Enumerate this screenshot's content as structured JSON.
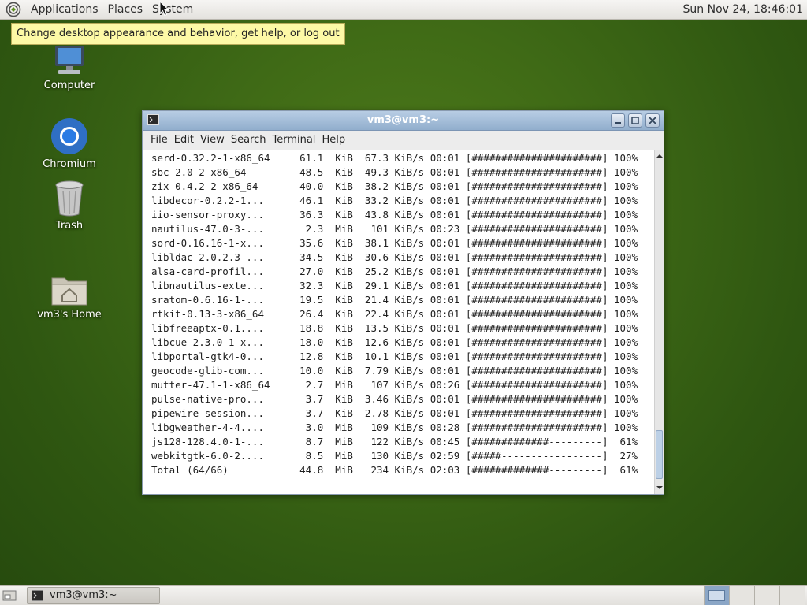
{
  "top_panel": {
    "menus": [
      "Applications",
      "Places",
      "System"
    ],
    "clock": "Sun Nov 24, 18:46:01"
  },
  "tooltip": "Change desktop appearance and behavior, get help, or log out",
  "desktop_icons": [
    {
      "label": "Computer",
      "icon": "computer-icon"
    },
    {
      "label": "Chromium",
      "icon": "chromium-icon"
    },
    {
      "label": "Trash",
      "icon": "trash-icon"
    },
    {
      "label": "vm3's Home",
      "icon": "home-folder-icon"
    }
  ],
  "terminal": {
    "title": "vm3@vm3:~",
    "menu": [
      "File",
      "Edit",
      "View",
      "Search",
      "Terminal",
      "Help"
    ],
    "lines": [
      "serd-0.32.2-1-x86_64     61.1  KiB  67.3 KiB/s 00:01 [######################] 100%",
      "sbc-2.0-2-x86_64         48.5  KiB  49.3 KiB/s 00:01 [######################] 100%",
      "zix-0.4.2-2-x86_64       40.0  KiB  38.2 KiB/s 00:01 [######################] 100%",
      "libdecor-0.2.2-1...      46.1  KiB  33.2 KiB/s 00:01 [######################] 100%",
      "iio-sensor-proxy...      36.3  KiB  43.8 KiB/s 00:01 [######################] 100%",
      "nautilus-47.0-3-...       2.3  MiB   101 KiB/s 00:23 [######################] 100%",
      "sord-0.16.16-1-x...      35.6  KiB  38.1 KiB/s 00:01 [######################] 100%",
      "libldac-2.0.2.3-...      34.5  KiB  30.6 KiB/s 00:01 [######################] 100%",
      "alsa-card-profil...      27.0  KiB  25.2 KiB/s 00:01 [######################] 100%",
      "libnautilus-exte...      32.3  KiB  29.1 KiB/s 00:01 [######################] 100%",
      "sratom-0.6.16-1-...      19.5  KiB  21.4 KiB/s 00:01 [######################] 100%",
      "rtkit-0.13-3-x86_64      26.4  KiB  22.4 KiB/s 00:01 [######################] 100%",
      "libfreeaptx-0.1....      18.8  KiB  13.5 KiB/s 00:01 [######################] 100%",
      "libcue-2.3.0-1-x...      18.0  KiB  12.6 KiB/s 00:01 [######################] 100%",
      "libportal-gtk4-0...      12.8  KiB  10.1 KiB/s 00:01 [######################] 100%",
      "geocode-glib-com...      10.0  KiB  7.79 KiB/s 00:01 [######################] 100%",
      "mutter-47.1-1-x86_64      2.7  MiB   107 KiB/s 00:26 [######################] 100%",
      "pulse-native-pro...       3.7  KiB  3.46 KiB/s 00:01 [######################] 100%",
      "pipewire-session...       3.7  KiB  2.78 KiB/s 00:01 [######################] 100%",
      "libgweather-4-4....       3.0  MiB   109 KiB/s 00:28 [######################] 100%",
      "js128-128.4.0-1-...       8.7  MiB   122 KiB/s 00:45 [#############---------]  61%",
      "webkitgtk-6.0-2....       8.5  MiB   130 KiB/s 02:59 [#####-----------------]  27%",
      "Total (64/66)            44.8  MiB   234 KiB/s 02:03 [#############---------]  61%"
    ]
  },
  "taskbar": {
    "window_button": "vm3@vm3:~",
    "workspaces": 4,
    "active_workspace": 1
  },
  "colors": {
    "desktop_green": "#3f6a16",
    "titlebar_blue": "#91aecd",
    "tooltip_yellow": "#fdf9a6"
  }
}
